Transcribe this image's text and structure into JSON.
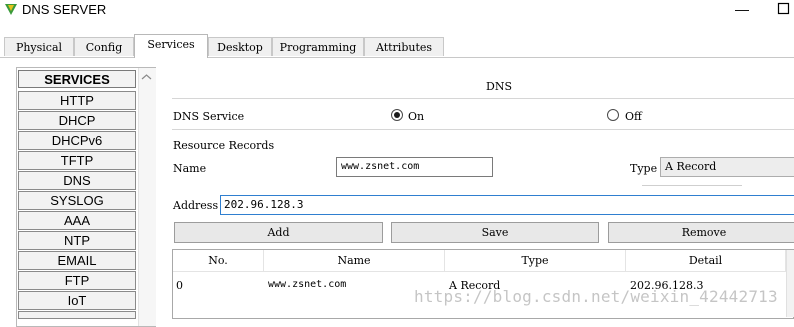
{
  "window": {
    "title": "DNS SERVER",
    "minimize_glyph": "—"
  },
  "tabs": [
    {
      "label": "Physical",
      "active": false
    },
    {
      "label": "Config",
      "active": false
    },
    {
      "label": "Services",
      "active": true
    },
    {
      "label": "Desktop",
      "active": false
    },
    {
      "label": "Programming",
      "active": false
    },
    {
      "label": "Attributes",
      "active": false
    }
  ],
  "sidebar": {
    "header": "SERVICES",
    "items": [
      "HTTP",
      "DHCP",
      "DHCPv6",
      "TFTP",
      "DNS",
      "SYSLOG",
      "AAA",
      "NTP",
      "EMAIL",
      "FTP",
      "IoT"
    ]
  },
  "dns": {
    "title": "DNS",
    "service_label": "DNS Service",
    "on_label": "On",
    "off_label": "Off",
    "service_state": "On",
    "resource_records_label": "Resource Records",
    "name_label": "Name",
    "name_value": "www.zsnet.com",
    "type_label": "Type",
    "type_value": "A Record",
    "address_label": "Address",
    "address_value": "202.96.128.3",
    "buttons": {
      "add": "Add",
      "save": "Save",
      "remove": "Remove"
    },
    "table": {
      "columns": [
        "No.",
        "Name",
        "Type",
        "Detail"
      ],
      "rows": [
        {
          "no": "0",
          "name": "www.zsnet.com",
          "type": "A Record",
          "detail": "202.96.128.3"
        }
      ]
    }
  },
  "watermark": "https://blog.csdn.net/weixin_42442713",
  "colors": {
    "address_focus_border": "#2f7fd0",
    "icon_green": "#3a9a3a",
    "icon_yellow": "#e3c21c"
  },
  "icons": {
    "app": "app-icon",
    "maximize": "maximize-icon",
    "scroll_up": "chevron-up-icon"
  }
}
